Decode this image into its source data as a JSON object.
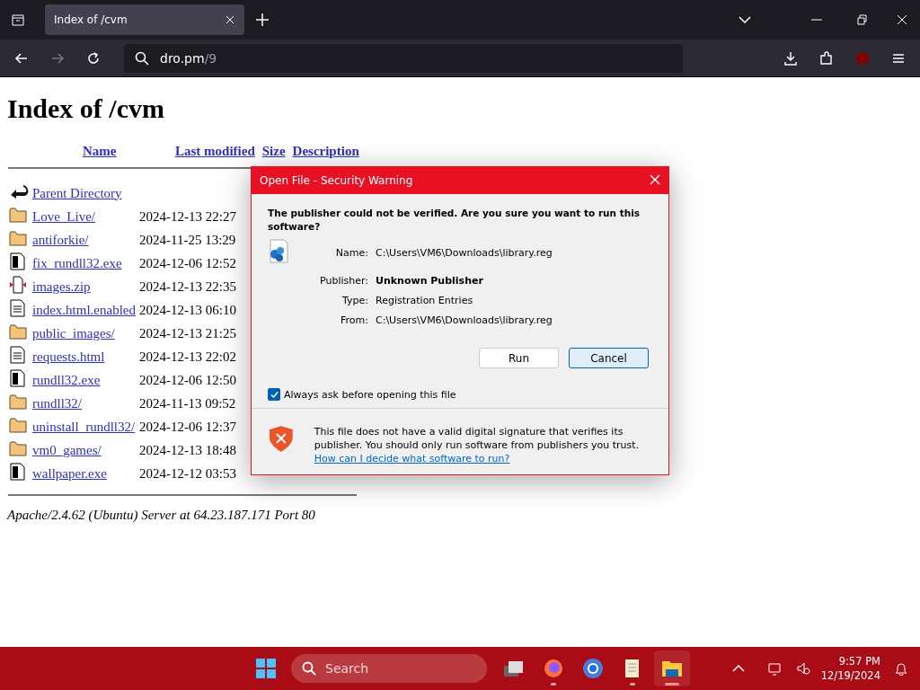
{
  "browser": {
    "tabs": [
      {
        "title": "Index of /cvm",
        "selected": true
      }
    ],
    "url": {
      "host": "dro.pm",
      "path": "/9"
    }
  },
  "page": {
    "title": "Index of /cvm",
    "columns": [
      "Name",
      "Last modified",
      "Size",
      "Description"
    ],
    "rows": [
      {
        "kind": "back",
        "name": "Parent Directory",
        "modified": ""
      },
      {
        "kind": "folder",
        "name": "Love_Live/",
        "modified": "2024-12-13 22:27"
      },
      {
        "kind": "folder",
        "name": "antiforkie/",
        "modified": "2024-11-25 13:29"
      },
      {
        "kind": "binary",
        "name": "fix_rundll32.exe",
        "modified": "2024-12-06 12:52"
      },
      {
        "kind": "archive",
        "name": "images.zip",
        "modified": "2024-12-13 22:35"
      },
      {
        "kind": "text",
        "name": "index.html.enabled",
        "modified": "2024-12-13 06:10"
      },
      {
        "kind": "folder",
        "name": "public_images/",
        "modified": "2024-12-13 21:25"
      },
      {
        "kind": "text",
        "name": "requests.html",
        "modified": "2024-12-13 22:02"
      },
      {
        "kind": "binary",
        "name": "rundll32.exe",
        "modified": "2024-12-06 12:50"
      },
      {
        "kind": "folder",
        "name": "rundll32/",
        "modified": "2024-11-13 09:52"
      },
      {
        "kind": "folder",
        "name": "uninstall_rundll32/",
        "modified": "2024-12-06 12:37"
      },
      {
        "kind": "folder",
        "name": "vm0_games/",
        "modified": "2024-12-13 18:48"
      },
      {
        "kind": "binary",
        "name": "wallpaper.exe",
        "modified": "2024-12-12 03:53"
      }
    ],
    "footer": "Apache/2.4.62 (Ubuntu) Server at 64.23.187.171 Port 80"
  },
  "dialog": {
    "title": "Open File - Security Warning",
    "question": "The publisher could not be verified.  Are you sure you want to run this software?",
    "fields": [
      {
        "label": "Name:",
        "value": "C:\\Users\\VM6\\Downloads\\library.reg",
        "bold": false
      },
      {
        "label": "Publisher:",
        "value": "Unknown Publisher",
        "bold": true
      },
      {
        "label": "Type:",
        "value": "Registration Entries",
        "bold": false
      },
      {
        "label": "From:",
        "value": "C:\\Users\\VM6\\Downloads\\library.reg",
        "bold": false
      }
    ],
    "buttons": [
      {
        "label": "Run",
        "focused": false
      },
      {
        "label": "Cancel",
        "focused": true
      }
    ],
    "checkbox": {
      "label": "Always ask before opening this file",
      "checked": true
    },
    "warning": "This file does not have a valid digital signature that verifies its publisher.  You should only run software from publishers you trust.",
    "link": "How can I decide what software to run?"
  },
  "taskbar": {
    "search": {
      "placeholder": "Search"
    },
    "apps": [
      {
        "kind": "taskview",
        "running": false,
        "active": false
      },
      {
        "kind": "firefox",
        "running": true,
        "active": false
      },
      {
        "kind": "chrome",
        "running": false,
        "active": false
      },
      {
        "kind": "notepad",
        "running": true,
        "active": false
      },
      {
        "kind": "explorer",
        "running": true,
        "active": true
      }
    ],
    "time": "9:57 PM",
    "date": "12/19/2024"
  }
}
